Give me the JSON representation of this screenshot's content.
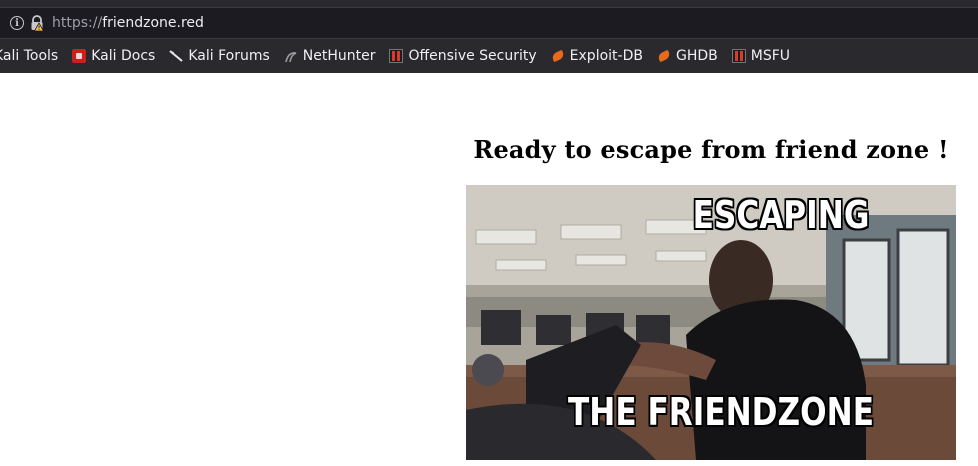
{
  "browser": {
    "url": {
      "scheme": "https://",
      "host": "friendzone.red"
    },
    "bookmarks": [
      {
        "label": "Kali Tools",
        "icon": "kali-dragon-icon"
      },
      {
        "label": "Kali Docs",
        "icon": "kali-docs-icon"
      },
      {
        "label": "Kali Forums",
        "icon": "kali-forums-icon"
      },
      {
        "label": "NetHunter",
        "icon": "nethunter-icon"
      },
      {
        "label": "Offensive Security",
        "icon": "offsec-icon"
      },
      {
        "label": "Exploit-DB",
        "icon": "exploit-db-icon"
      },
      {
        "label": "GHDB",
        "icon": "ghdb-icon"
      },
      {
        "label": "MSFU",
        "icon": "msfu-icon"
      }
    ]
  },
  "page": {
    "headline": "Ready to escape from friend zone !",
    "meme": {
      "top_text": "ESCAPING",
      "bottom_text": "THE FRIENDZONE"
    }
  },
  "colors": {
    "chrome_bg": "#2a2a2e",
    "urlbar_bg": "#1c1b22",
    "page_bg": "#ffffff"
  }
}
